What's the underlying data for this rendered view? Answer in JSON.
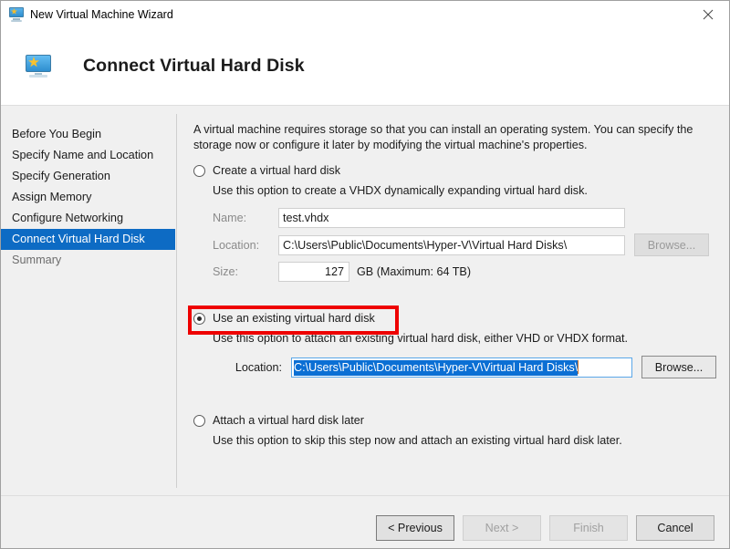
{
  "window": {
    "title": "New Virtual Machine Wizard",
    "title_icon": "virtual-machine-icon",
    "close_icon": "close-icon"
  },
  "header": {
    "title": "Connect Virtual Hard Disk",
    "icon": "virtual-machine-icon"
  },
  "sidebar": {
    "items": [
      {
        "label": "Before You Begin",
        "state": "normal"
      },
      {
        "label": "Specify Name and Location",
        "state": "normal"
      },
      {
        "label": "Specify Generation",
        "state": "normal"
      },
      {
        "label": "Assign Memory",
        "state": "normal"
      },
      {
        "label": "Configure Networking",
        "state": "normal"
      },
      {
        "label": "Connect Virtual Hard Disk",
        "state": "selected"
      },
      {
        "label": "Summary",
        "state": "muted"
      }
    ]
  },
  "content": {
    "intro": "A virtual machine requires storage so that you can install an operating system. You can specify the storage now or configure it later by modifying the virtual machine's properties.",
    "options": [
      {
        "id": "create-virtual-hard-disk",
        "label": "Create a virtual hard disk",
        "description": "Use this option to create a VHDX dynamically expanding virtual hard disk.",
        "selected": false,
        "enabled": false,
        "fields": {
          "name_label": "Name:",
          "name_value": "test.vhdx",
          "location_label": "Location:",
          "location_value": "C:\\Users\\Public\\Documents\\Hyper-V\\Virtual Hard Disks\\",
          "browse_label": "Browse...",
          "size_label": "Size:",
          "size_value": "127",
          "size_unit": "GB (Maximum: 64 TB)"
        }
      },
      {
        "id": "use-existing-virtual-hard-disk",
        "label": "Use an existing virtual hard disk",
        "description": "Use this option to attach an existing virtual hard disk, either VHD or VHDX format.",
        "selected": true,
        "enabled": true,
        "fields": {
          "location_label": "Location:",
          "location_value": "C:\\Users\\Public\\Documents\\Hyper-V\\Virtual Hard Disks\\",
          "browse_label": "Browse..."
        }
      },
      {
        "id": "attach-virtual-hard-disk-later",
        "label": "Attach a virtual hard disk later",
        "description": "Use this option to skip this step now and attach an existing virtual hard disk later.",
        "selected": false,
        "enabled": true
      }
    ]
  },
  "annotation": {
    "color": "#ee0000",
    "target": "use-existing-virtual-hard-disk"
  },
  "footer": {
    "buttons": [
      {
        "label": "< Previous",
        "enabled": true,
        "default": true
      },
      {
        "label": "Next >",
        "enabled": false,
        "default": false
      },
      {
        "label": "Finish",
        "enabled": false,
        "default": false
      },
      {
        "label": "Cancel",
        "enabled": true,
        "default": false
      }
    ]
  },
  "colors": {
    "selection_blue": "#0d6bc4",
    "annotation_red": "#ee0000",
    "caret_orange": "#d4762a"
  }
}
